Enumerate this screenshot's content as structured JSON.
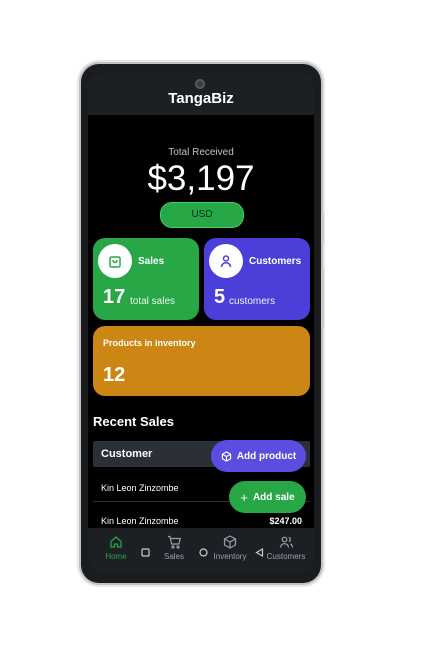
{
  "app": {
    "title": "TangaBiz"
  },
  "summary": {
    "total_label": "Total Received",
    "total_amount": "$3,197",
    "currency": "USD"
  },
  "cards": {
    "sales": {
      "title": "Sales",
      "count": "17",
      "sub": "total sales",
      "icon": "shopping-bag-icon"
    },
    "customers": {
      "title": "Customers",
      "count": "5",
      "sub": "customers",
      "icon": "user-icon"
    },
    "inventory": {
      "title": "Products in inventory",
      "count": "12"
    }
  },
  "recent_sales": {
    "title": "Recent Sales",
    "column_customer": "Customer",
    "rows": [
      {
        "customer": "Kin Leon Zinzombe",
        "amount": ""
      },
      {
        "customer": "Kin Leon Zinzombe",
        "amount": "$247.00"
      }
    ]
  },
  "fabs": {
    "add_product": "Add product",
    "add_sale": "Add sale"
  },
  "nav": {
    "home": "Home",
    "sales": "Sales",
    "inventory": "Inventory",
    "customers": "Customers"
  },
  "colors": {
    "green": "#27a745",
    "purple": "#4b3fd9",
    "amber": "#cc8614",
    "background": "#000000"
  }
}
